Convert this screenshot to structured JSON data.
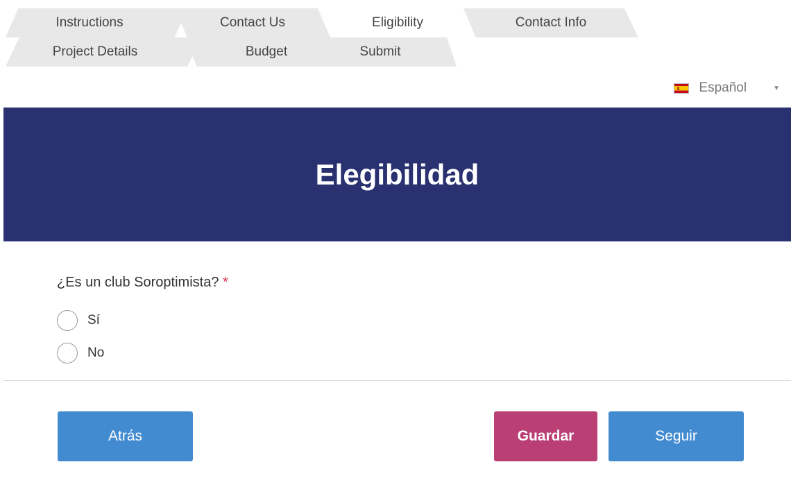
{
  "tabs": {
    "items": [
      {
        "label": "Instructions"
      },
      {
        "label": "Contact Us"
      },
      {
        "label": "Eligibility"
      },
      {
        "label": "Contact Info"
      },
      {
        "label": "Project Details"
      },
      {
        "label": "Budget"
      },
      {
        "label": "Submit"
      }
    ],
    "active_index": 2
  },
  "language": {
    "selected": "Español",
    "flag_icon": "spain-flag-icon"
  },
  "banner": {
    "title": "Elegibilidad",
    "background": "#2a3170"
  },
  "question": {
    "text": "¿Es un club Soroptimista?",
    "required_marker": "*",
    "options": [
      {
        "label": "Sí"
      },
      {
        "label": "No"
      }
    ]
  },
  "buttons": {
    "back": "Atrás",
    "save": "Guardar",
    "next": "Seguir"
  },
  "colors": {
    "primary_button": "#428bd1",
    "save_button": "#b93f74",
    "required": "#d9304e"
  }
}
